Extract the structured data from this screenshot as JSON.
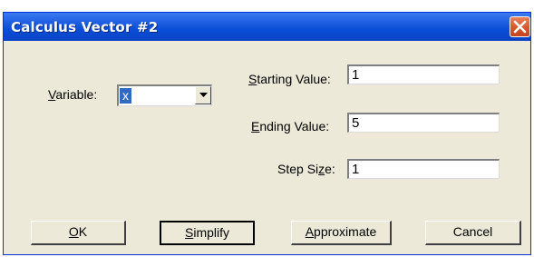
{
  "window": {
    "title": "Calculus Vector #2"
  },
  "form": {
    "variable": {
      "label_pre": "",
      "label_ul": "V",
      "label_post": "ariable:",
      "value": "x"
    },
    "starting_value": {
      "label_pre": "",
      "label_ul": "S",
      "label_post": "tarting Value:",
      "value": "1"
    },
    "ending_value": {
      "label_pre": "",
      "label_ul": "E",
      "label_post": "nding Value:",
      "value": "5"
    },
    "step_size": {
      "label_pre": "Step Si",
      "label_ul": "z",
      "label_post": "e:",
      "value": "1"
    }
  },
  "buttons": {
    "ok": {
      "pre": "",
      "ul": "O",
      "post": "K"
    },
    "simplify": {
      "pre": "",
      "ul": "S",
      "post": "implify"
    },
    "approximate": {
      "pre": "",
      "ul": "A",
      "post": "pproximate"
    },
    "cancel": {
      "label": "Cancel"
    }
  },
  "icons": {
    "close": "close-icon",
    "dropdown": "chevron-down-icon"
  },
  "colors": {
    "titlebar": "#0a4dd8",
    "close_button": "#d5532b",
    "dialog_bg": "#ece9d8",
    "selection": "#316ac5"
  }
}
